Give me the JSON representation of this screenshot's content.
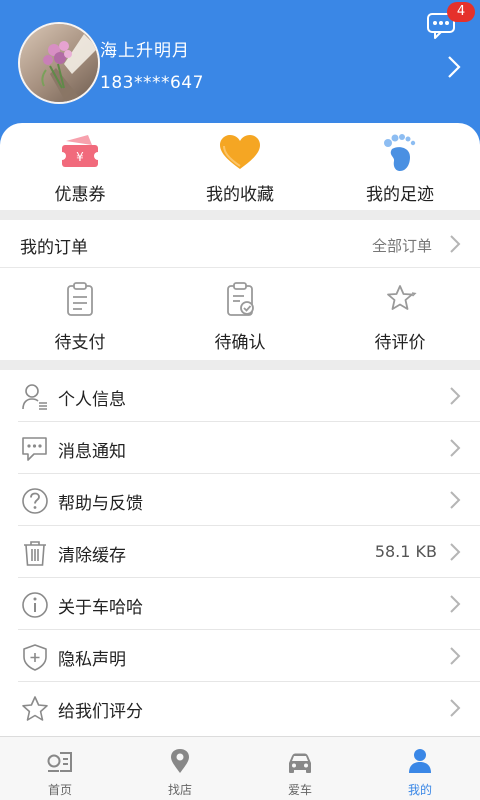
{
  "profile": {
    "username": "海上升明月",
    "phone": "183****647",
    "message_count": "4"
  },
  "quick_links": [
    {
      "label": "优惠券",
      "icon": "coupon-icon"
    },
    {
      "label": "我的收藏",
      "icon": "heart-icon"
    },
    {
      "label": "我的足迹",
      "icon": "footprint-icon"
    }
  ],
  "orders": {
    "title": "我的订单",
    "all_label": "全部订单",
    "items": [
      {
        "label": "待支付",
        "icon": "clipboard-icon"
      },
      {
        "label": "待确认",
        "icon": "clipboard-check-icon"
      },
      {
        "label": "待评价",
        "icon": "stars-icon"
      }
    ]
  },
  "menu": [
    {
      "label": "个人信息",
      "icon": "person-icon",
      "value": ""
    },
    {
      "label": "消息通知",
      "icon": "chat-icon",
      "value": ""
    },
    {
      "label": "帮助与反馈",
      "icon": "question-icon",
      "value": ""
    },
    {
      "label": "清除缓存",
      "icon": "trash-icon",
      "value": "58.1 KB"
    },
    {
      "label": "关于车哈哈",
      "icon": "info-icon",
      "value": ""
    },
    {
      "label": "隐私声明",
      "icon": "shield-icon",
      "value": ""
    },
    {
      "label": "给我们评分",
      "icon": "star-icon",
      "value": ""
    }
  ],
  "tabs": [
    {
      "label": "首页",
      "icon": "home-icon"
    },
    {
      "label": "找店",
      "icon": "location-icon"
    },
    {
      "label": "爱车",
      "icon": "car-icon"
    },
    {
      "label": "我的",
      "icon": "user-icon"
    }
  ],
  "colors": {
    "primary": "#3a87e6",
    "badge": "#e5312b",
    "coupon": "#f16a7c",
    "favorite": "#f5a623",
    "footprint": "#4a90e2"
  }
}
